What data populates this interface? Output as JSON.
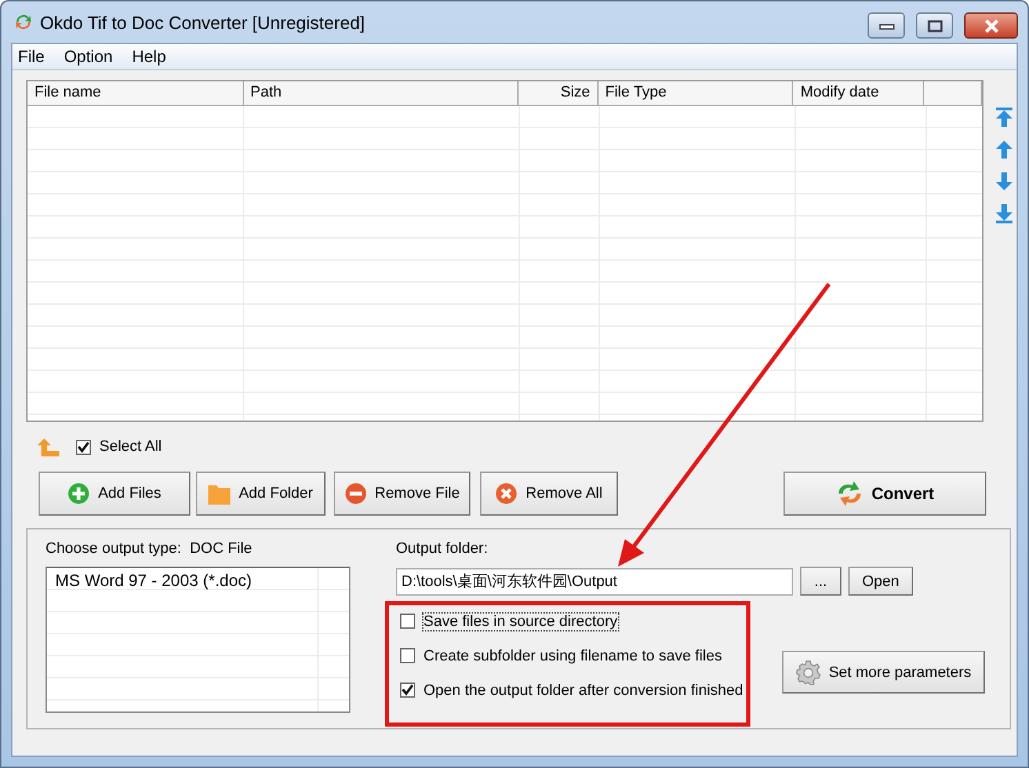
{
  "window": {
    "title": "Okdo Tif to Doc Converter [Unregistered]"
  },
  "menu": [
    "File",
    "Option",
    "Help"
  ],
  "table": {
    "columns": [
      "File name",
      "Path",
      "Size",
      "File Type",
      "Modify date"
    ]
  },
  "select_all": {
    "label": "Select All",
    "checked": true
  },
  "buttons": [
    "Add Files",
    "Add Folder",
    "Remove File",
    "Remove All"
  ],
  "convert_button": "Convert",
  "output_type": {
    "label": "Choose output type:",
    "value": "DOC File",
    "options": [
      "MS Word 97 - 2003 (*.doc)"
    ]
  },
  "output_folder": {
    "label": "Output folder:",
    "value": "D:\\tools\\桌面\\河东软件园\\Output",
    "browse_button": "...",
    "open_button": "Open"
  },
  "options": [
    {
      "label": "Save files in source directory",
      "checked": false,
      "focused": true
    },
    {
      "label": "Create subfolder using filename to save files",
      "checked": false,
      "focused": false
    },
    {
      "label": "Open the output folder after conversion finished",
      "checked": true,
      "focused": false
    }
  ],
  "more_button": "Set more parameters"
}
